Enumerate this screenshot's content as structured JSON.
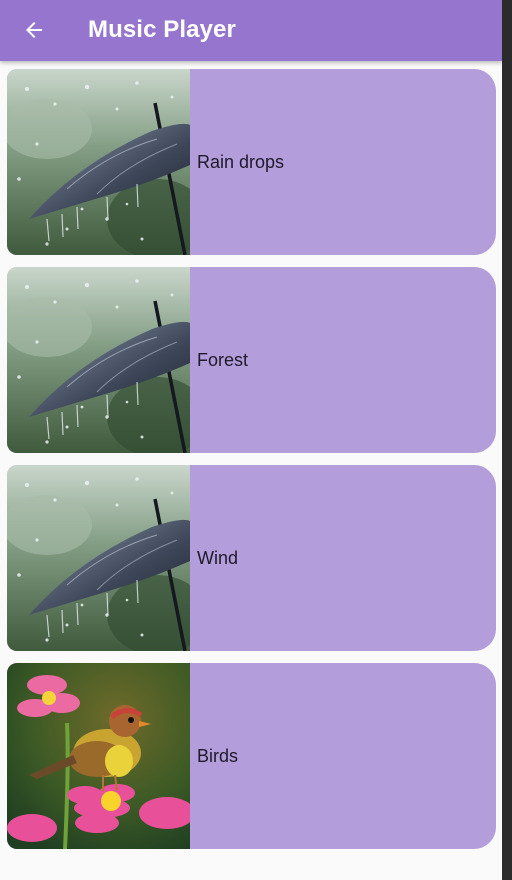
{
  "appbar": {
    "title": "Music Player",
    "back_icon": "arrow-left-icon"
  },
  "colors": {
    "appbar": "#9575cd",
    "card": "#b39ddb",
    "background": "#fafafa"
  },
  "tracks": [
    {
      "title": "Rain drops",
      "image": "umbrella-in-rain"
    },
    {
      "title": "Forest",
      "image": "umbrella-in-rain"
    },
    {
      "title": "Wind",
      "image": "umbrella-in-rain"
    },
    {
      "title": "Birds",
      "image": "bird-on-pink-flower"
    }
  ]
}
